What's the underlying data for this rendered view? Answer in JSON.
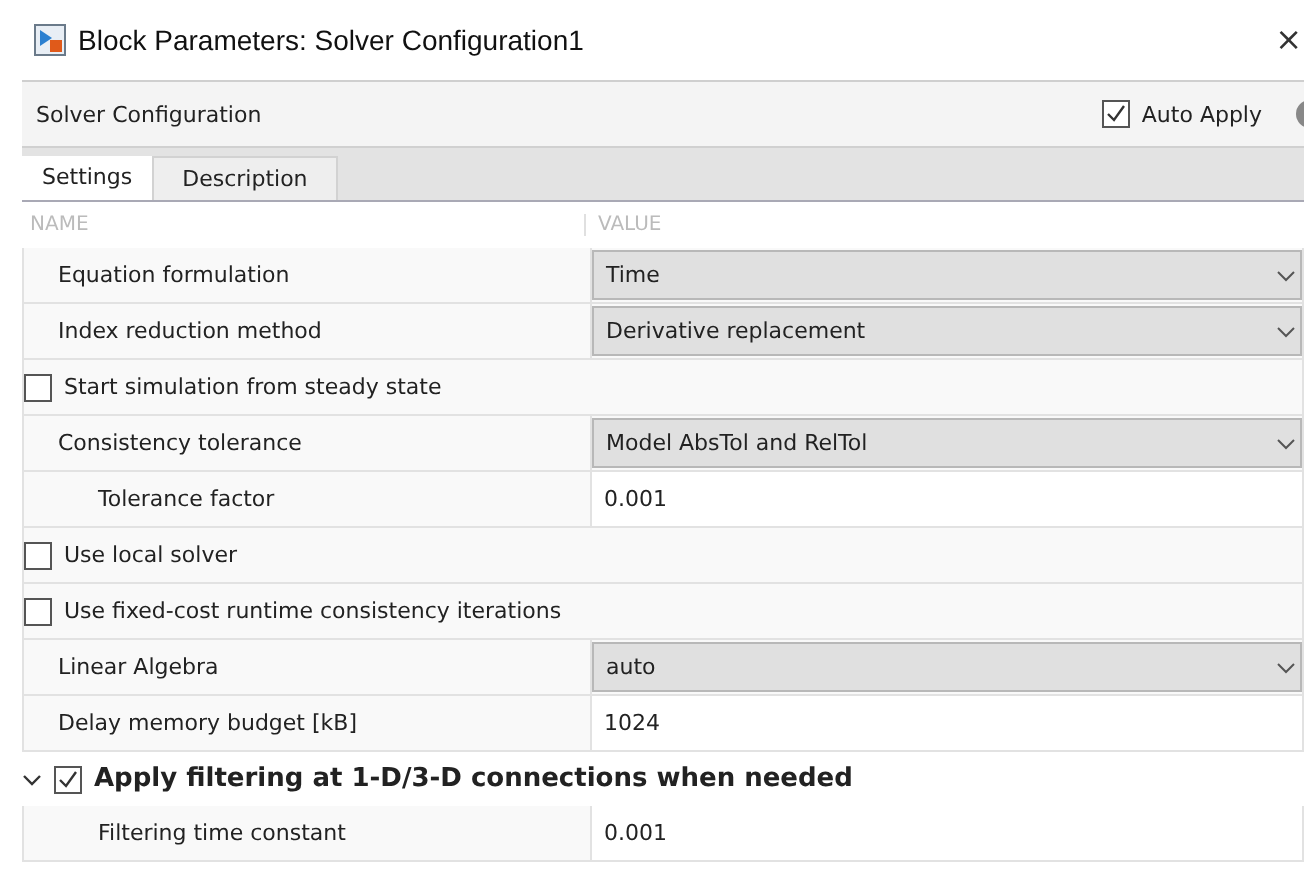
{
  "window": {
    "title": "Block Parameters: Solver Configuration1",
    "close": "×"
  },
  "header": {
    "title": "Solver Configuration",
    "auto_apply": {
      "label": "Auto Apply",
      "checked": true
    }
  },
  "tabs": [
    {
      "label": "Settings",
      "selected": true
    },
    {
      "label": "Description",
      "selected": false
    }
  ],
  "table": {
    "columns": [
      "NAME",
      "VALUE"
    ],
    "rows": [
      {
        "kind": "dropdown",
        "name": "Equation formulation",
        "value": "Time"
      },
      {
        "kind": "dropdown",
        "name": "Index reduction method",
        "value": "Derivative replacement"
      },
      {
        "kind": "checkbox",
        "name": "Start simulation from steady state",
        "checked": false
      },
      {
        "kind": "dropdown",
        "name": "Consistency tolerance",
        "value": "Model AbsTol and RelTol",
        "children": [
          {
            "kind": "edit",
            "name": "Tolerance factor",
            "value": "0.001"
          }
        ]
      },
      {
        "kind": "checkbox",
        "name": "Use local solver",
        "checked": false
      },
      {
        "kind": "checkbox",
        "name": "Use fixed-cost runtime consistency iterations",
        "checked": false
      },
      {
        "kind": "dropdown",
        "name": "Linear Algebra",
        "value": "auto"
      },
      {
        "kind": "edit",
        "name": "Delay memory budget [kB]",
        "value": "1024"
      },
      {
        "kind": "group",
        "name": "Apply filtering at 1-D/3-D connections when needed",
        "checked": true,
        "expanded": true,
        "children": [
          {
            "kind": "edit",
            "name": "Filtering time constant",
            "value": "0.001"
          }
        ]
      }
    ]
  }
}
